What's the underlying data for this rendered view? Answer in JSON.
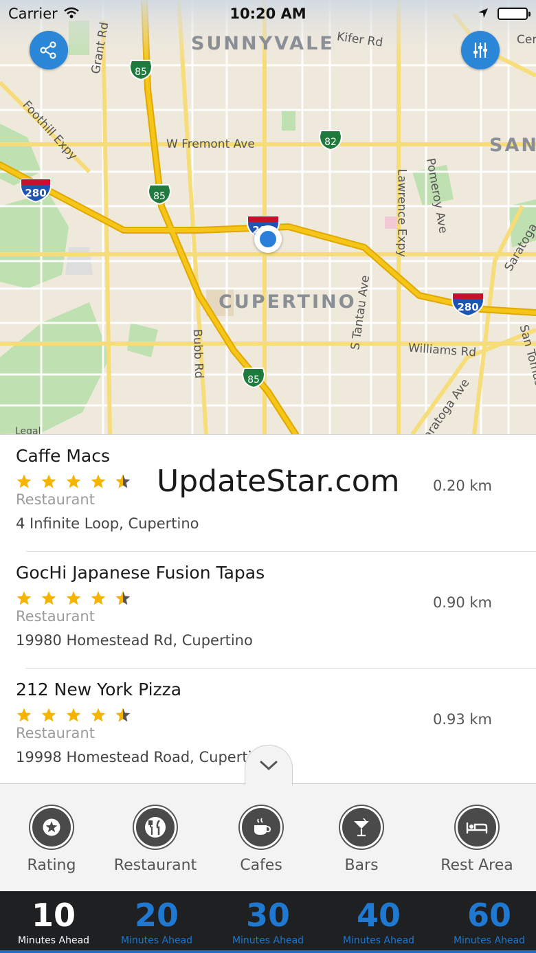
{
  "status_bar": {
    "carrier": "Carrier",
    "time": "10:20 AM"
  },
  "map": {
    "cities": [
      "SUNNYVALE",
      "CUPERTINO",
      "SAN"
    ],
    "streets": [
      "Kifer Rd",
      "Grant Rd",
      "Foothill Expy",
      "W Fremont Ave",
      "Lawrence Expy",
      "Pomeroy Ave",
      "Saratoga",
      "S Tantau Ave",
      "Williams Rd",
      "Bubb Rd",
      "San Tomas Expy",
      "Saratoga Ave",
      "Cer"
    ],
    "highway_shields": [
      "85",
      "82",
      "280",
      "85",
      "280",
      "280",
      "85"
    ],
    "legal": "Legal"
  },
  "watermark": "UpdateStar.com",
  "places": [
    {
      "name": "Caffe Macs",
      "rating": 4.5,
      "category": "Restaurant",
      "address": "4 Infinite Loop, Cupertino",
      "distance": "0.20 km"
    },
    {
      "name": "GocHi Japanese Fusion Tapas",
      "rating": 4.5,
      "category": "Restaurant",
      "address": "19980 Homestead Rd, Cupertino",
      "distance": "0.90 km"
    },
    {
      "name": "212 New York Pizza",
      "rating": 4.5,
      "category": "Restaurant",
      "address": "19998 Homestead Road, Cupertin",
      "distance": "0.93 km"
    }
  ],
  "categories": [
    {
      "label": "Rating",
      "icon": "star-icon"
    },
    {
      "label": "Restaurant",
      "icon": "fork-knife-icon"
    },
    {
      "label": "Cafes",
      "icon": "coffee-cup-icon"
    },
    {
      "label": "Bars",
      "icon": "cocktail-icon"
    },
    {
      "label": "Rest Area",
      "icon": "bed-icon"
    }
  ],
  "time_tabs": [
    {
      "value": "10",
      "label": "Minutes Ahead",
      "active": true
    },
    {
      "value": "20",
      "label": "Minutes Ahead",
      "active": false
    },
    {
      "value": "30",
      "label": "Minutes Ahead",
      "active": false
    },
    {
      "value": "40",
      "label": "Minutes Ahead",
      "active": false
    },
    {
      "value": "60",
      "label": "Minutes Ahead",
      "active": false
    }
  ],
  "colors": {
    "accent_blue": "#2a86d6",
    "star_yellow": "#f4b400",
    "highway_yellow": "#f2c21b",
    "time_bar_bg": "#1f2022"
  }
}
